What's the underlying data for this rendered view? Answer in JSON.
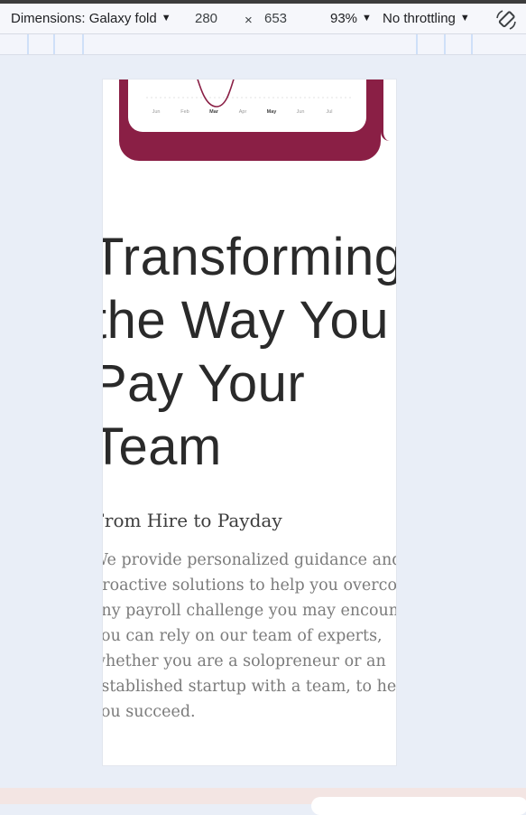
{
  "toolbar": {
    "dimensions_label": "Dimensions: Galaxy fold",
    "width_value": "280",
    "times_symbol": "×",
    "height_value": "653",
    "zoom_label": "93%",
    "throttling_label": "No throttling",
    "caret": "▼"
  },
  "chart": {
    "months": [
      "Jun",
      "Feb",
      "Mar",
      "Apr",
      "May",
      "Jun",
      "Jul"
    ],
    "accent": "#8a1f45"
  },
  "hero": {
    "headline_lines": [
      "Transforming",
      "the Way You",
      "Pay Your",
      "Team"
    ],
    "subheading": "From Hire to Payday",
    "paragraph_lines": [
      "We provide personalized guidance and",
      "proactive solutions to help you overcome",
      "any payroll challenge you may encounter.",
      "You can rely on our team of experts,",
      "whether you are a solopreneur or an",
      "established startup with a team, to help",
      "you succeed."
    ]
  }
}
